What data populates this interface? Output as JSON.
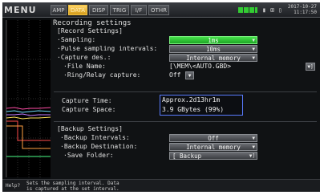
{
  "menu_label": "MENU",
  "tabs": [
    {
      "label": "AMP",
      "active": false
    },
    {
      "label": "DATA",
      "active": true
    },
    {
      "label": "DISP",
      "active": false
    },
    {
      "label": "TRIG",
      "active": false
    },
    {
      "label": "I/F",
      "active": false
    },
    {
      "label": "OTHR",
      "active": false
    }
  ],
  "status": {
    "battery_color": "#33cc33",
    "clock_date": "2017-10-27",
    "clock_time": "11:17:50"
  },
  "panel": {
    "title": "Recording settings",
    "record_section": "[Record Settings]",
    "sampling_label": "·Sampling:",
    "sampling_value": "1ms",
    "pulse_label": "·Pulse sampling intervals:",
    "pulse_value": "10ms",
    "capture_dest_label": "·Capture des.:",
    "capture_dest_value": "Internal memory",
    "file_name_label": "·File Name:",
    "file_name_value": "[\\MEM\\<AUTO.GBD>",
    "ring_label": "·Ring/Relay capture:",
    "ring_value": "Off",
    "capture_time_label": "Capture Time:",
    "capture_time_value": "Approx.2d13hr1m",
    "capture_space_label": "Capture Space:",
    "capture_space_value": "3.9 GBytes (99%)",
    "backup_section": "[Backup Settings]",
    "backup_intervals_label": "·Backup Intervals:",
    "backup_intervals_value": "Off",
    "backup_dest_label": "·Backup Destination:",
    "backup_dest_value": "Internal memory",
    "save_folder_label": "·Save Folder:",
    "save_folder_value": "[ Backup"
  },
  "help": {
    "label": "Help?",
    "line1": "Sets the sampling interval. Data",
    "line2": "is captured at the set interval."
  },
  "colors": {
    "selected_field": "#2fc436",
    "info_box_border": "#5a7cff",
    "active_tab": "#e8b030"
  }
}
